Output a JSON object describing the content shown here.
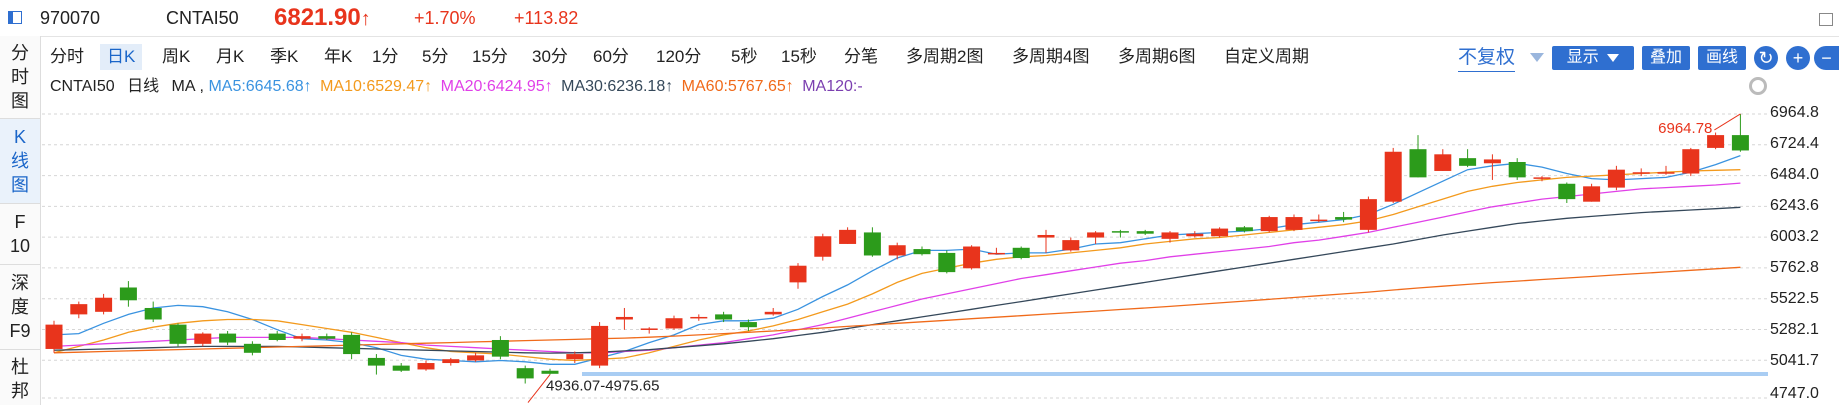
{
  "header": {
    "code": "970070",
    "name": "CNTAI50",
    "price": "6821.90",
    "price_arrow": "↑",
    "change_pct": "+1.70%",
    "change_abs": "+113.82"
  },
  "sidebar": {
    "items": [
      {
        "label": "分\n时\n图"
      },
      {
        "label": "K\n线\n图"
      },
      {
        "label": "F\n10"
      },
      {
        "label": "深\n度\nF9"
      },
      {
        "label": "杜\n邦"
      }
    ]
  },
  "periods": [
    "分时",
    "日K",
    "周K",
    "月K",
    "季K",
    "年K",
    "1分",
    "5分",
    "15分",
    "30分",
    "60分",
    "120分",
    "5秒",
    "15秒",
    "分笔",
    "多周期2图",
    "多周期4图",
    "多周期6图",
    "自定义周期"
  ],
  "toolbar": {
    "adjust_label": "不复权",
    "display_label": "显示",
    "overlay_label": "叠加",
    "draw_label": "画线",
    "refresh_icon": "↻",
    "zoom_in_icon": "+",
    "zoom_out_icon": "−"
  },
  "legend": {
    "title": "CNTAI50",
    "period": "日线",
    "ma_label": "MA",
    "ma5": "MA5:6645.68↑",
    "ma10": "MA10:6529.47↑",
    "ma20": "MA20:6424.95↑",
    "ma30": "MA30:6236.18↑",
    "ma60": "MA60:5767.65↑",
    "ma120": "MA120:-"
  },
  "colors": {
    "up": "#e8341c",
    "down": "#2c9b1b",
    "ma5": "#3a93e0",
    "ma10": "#f39a1d",
    "ma20": "#e040e8",
    "ma30": "#35485a",
    "ma60": "#f06a1a",
    "ma120": "#7b3fb0",
    "accent": "#2f6fd0"
  },
  "chart_data": {
    "type": "candlestick",
    "y_ticks": [
      "6964.8",
      "6724.4",
      "6484.0",
      "6243.6",
      "6003.2",
      "5762.8",
      "5522.5",
      "5282.1",
      "5041.7",
      "4747.0"
    ],
    "ylim": [
      4747.0,
      6964.8
    ],
    "high_label": "6964.78",
    "low_label": "4936.07-4975.65",
    "candles": [
      [
        5130,
        5320,
        5100,
        5350
      ],
      [
        5400,
        5480,
        5370,
        5500
      ],
      [
        5420,
        5530,
        5400,
        5560
      ],
      [
        5610,
        5510,
        5460,
        5660
      ],
      [
        5450,
        5360,
        5340,
        5500
      ],
      [
        5320,
        5170,
        5150,
        5330
      ],
      [
        5170,
        5250,
        5150,
        5260
      ],
      [
        5250,
        5180,
        5160,
        5270
      ],
      [
        5170,
        5100,
        5080,
        5190
      ],
      [
        5250,
        5200,
        5190,
        5270
      ],
      [
        5210,
        5230,
        5190,
        5250
      ],
      [
        5230,
        5210,
        5200,
        5250
      ],
      [
        5240,
        5090,
        5050,
        5260
      ],
      [
        5060,
        5000,
        4930,
        5090
      ],
      [
        5000,
        4960,
        4950,
        5020
      ],
      [
        4970,
        5020,
        4960,
        5040
      ],
      [
        5020,
        5050,
        5000,
        5060
      ],
      [
        5040,
        5080,
        5030,
        5100
      ],
      [
        5200,
        5070,
        5050,
        5230
      ],
      [
        4980,
        4900,
        4860,
        5000
      ],
      [
        4960,
        4936,
        4930,
        4975
      ],
      [
        5050,
        5090,
        5020,
        5110
      ],
      [
        5000,
        5310,
        4980,
        5340
      ],
      [
        5360,
        5380,
        5280,
        5450
      ],
      [
        5290,
        5290,
        5250,
        5300
      ],
      [
        5290,
        5370,
        5280,
        5390
      ],
      [
        5370,
        5380,
        5350,
        5400
      ],
      [
        5400,
        5360,
        5340,
        5420
      ],
      [
        5340,
        5300,
        5270,
        5360
      ],
      [
        5400,
        5420,
        5390,
        5450
      ],
      [
        5650,
        5780,
        5600,
        5800
      ],
      [
        5850,
        6010,
        5820,
        6030
      ],
      [
        5950,
        6060,
        5950,
        6080
      ],
      [
        6040,
        5860,
        5850,
        6080
      ],
      [
        5860,
        5940,
        5830,
        5960
      ],
      [
        5910,
        5870,
        5860,
        5930
      ],
      [
        5880,
        5730,
        5720,
        5900
      ],
      [
        5760,
        5930,
        5750,
        5940
      ],
      [
        5880,
        5880,
        5870,
        5920
      ],
      [
        5920,
        5840,
        5830,
        5930
      ],
      [
        6000,
        6020,
        5880,
        6060
      ],
      [
        5900,
        5980,
        5890,
        6000
      ],
      [
        6000,
        6040,
        5950,
        6050
      ],
      [
        6050,
        6040,
        6000,
        6060
      ],
      [
        6050,
        6030,
        6020,
        6060
      ],
      [
        5990,
        6040,
        5960,
        6050
      ],
      [
        6010,
        6030,
        6000,
        6050
      ],
      [
        6010,
        6070,
        6000,
        6080
      ],
      [
        6080,
        6050,
        6040,
        6090
      ],
      [
        6050,
        6160,
        6040,
        6170
      ],
      [
        6060,
        6160,
        6050,
        6180
      ],
      [
        6140,
        6140,
        6120,
        6180
      ],
      [
        6160,
        6140,
        6120,
        6200
      ],
      [
        6060,
        6300,
        6040,
        6320
      ],
      [
        6280,
        6670,
        6270,
        6700
      ],
      [
        6690,
        6470,
        6470,
        6800
      ],
      [
        6520,
        6650,
        6520,
        6690
      ],
      [
        6620,
        6560,
        6550,
        6690
      ],
      [
        6580,
        6610,
        6450,
        6650
      ],
      [
        6590,
        6470,
        6450,
        6620
      ],
      [
        6470,
        6470,
        6440,
        6480
      ],
      [
        6420,
        6300,
        6270,
        6430
      ],
      [
        6280,
        6400,
        6280,
        6420
      ],
      [
        6390,
        6530,
        6370,
        6560
      ],
      [
        6500,
        6510,
        6480,
        6540
      ],
      [
        6500,
        6510,
        6490,
        6560
      ],
      [
        6500,
        6690,
        6480,
        6700
      ],
      [
        6700,
        6800,
        6690,
        6820
      ],
      [
        6800,
        6680,
        6670,
        6965
      ]
    ],
    "ma": {
      "ma5": [
        5240,
        5250,
        5330,
        5400,
        5450,
        5470,
        5460,
        5420,
        5360,
        5280,
        5210,
        5200,
        5180,
        5140,
        5080,
        5050,
        5040,
        5030,
        5040,
        5030,
        5010,
        5010,
        5060,
        5110,
        5180,
        5240,
        5320,
        5350,
        5350,
        5370,
        5440,
        5540,
        5630,
        5740,
        5840,
        5900,
        5900,
        5910,
        5870,
        5880,
        5880,
        5910,
        5950,
        5960,
        5990,
        6020,
        6030,
        6040,
        6050,
        6070,
        6100,
        6120,
        6140,
        6180,
        6260,
        6350,
        6440,
        6530,
        6560,
        6580,
        6550,
        6500,
        6460,
        6450,
        6460,
        6470,
        6510,
        6570,
        6640
      ],
      "ma10": [
        5100,
        5150,
        5200,
        5260,
        5300,
        5330,
        5350,
        5360,
        5360,
        5350,
        5320,
        5290,
        5260,
        5220,
        5180,
        5140,
        5110,
        5100,
        5090,
        5070,
        5050,
        5040,
        5050,
        5060,
        5100,
        5150,
        5200,
        5240,
        5270,
        5310,
        5360,
        5420,
        5480,
        5560,
        5650,
        5720,
        5760,
        5800,
        5830,
        5850,
        5860,
        5880,
        5900,
        5920,
        5950,
        5970,
        5990,
        6000,
        6020,
        6040,
        6060,
        6080,
        6100,
        6130,
        6180,
        6240,
        6300,
        6360,
        6400,
        6430,
        6450,
        6470,
        6480,
        6490,
        6500,
        6510,
        6520,
        6525,
        6530
      ],
      "ma20": [
        5150,
        5160,
        5170,
        5180,
        5190,
        5200,
        5210,
        5220,
        5220,
        5220,
        5220,
        5210,
        5200,
        5190,
        5180,
        5160,
        5150,
        5140,
        5130,
        5120,
        5110,
        5100,
        5100,
        5110,
        5120,
        5140,
        5160,
        5180,
        5210,
        5240,
        5280,
        5320,
        5370,
        5420,
        5470,
        5520,
        5560,
        5600,
        5640,
        5680,
        5710,
        5740,
        5770,
        5800,
        5820,
        5850,
        5870,
        5890,
        5910,
        5930,
        5960,
        5980,
        6010,
        6040,
        6080,
        6120,
        6160,
        6200,
        6240,
        6270,
        6300,
        6320,
        6340,
        6360,
        6380,
        6390,
        6400,
        6410,
        6425
      ],
      "ma30": [
        5120,
        5125,
        5130,
        5135,
        5140,
        5145,
        5150,
        5150,
        5150,
        5150,
        5145,
        5140,
        5135,
        5130,
        5125,
        5120,
        5115,
        5110,
        5105,
        5100,
        5098,
        5100,
        5105,
        5115,
        5125,
        5140,
        5155,
        5170,
        5190,
        5210,
        5235,
        5260,
        5290,
        5320,
        5350,
        5380,
        5410,
        5440,
        5470,
        5500,
        5530,
        5560,
        5590,
        5620,
        5650,
        5680,
        5710,
        5740,
        5770,
        5800,
        5830,
        5860,
        5890,
        5920,
        5950,
        5985,
        6020,
        6050,
        6080,
        6110,
        6130,
        6150,
        6165,
        6180,
        6195,
        6205,
        6215,
        6225,
        6236
      ],
      "ma60": [
        5100,
        5105,
        5110,
        5115,
        5120,
        5125,
        5130,
        5135,
        5140,
        5145,
        5150,
        5155,
        5160,
        5165,
        5170,
        5175,
        5180,
        5185,
        5190,
        5195,
        5200,
        5205,
        5210,
        5215,
        5222,
        5230,
        5240,
        5250,
        5260,
        5270,
        5282,
        5294,
        5306,
        5318,
        5330,
        5342,
        5354,
        5366,
        5378,
        5390,
        5402,
        5414,
        5426,
        5438,
        5450,
        5462,
        5476,
        5490,
        5504,
        5518,
        5532,
        5546,
        5560,
        5574,
        5590,
        5606,
        5620,
        5634,
        5648,
        5660,
        5672,
        5684,
        5696,
        5708,
        5720,
        5732,
        5744,
        5756,
        5768
      ]
    }
  }
}
